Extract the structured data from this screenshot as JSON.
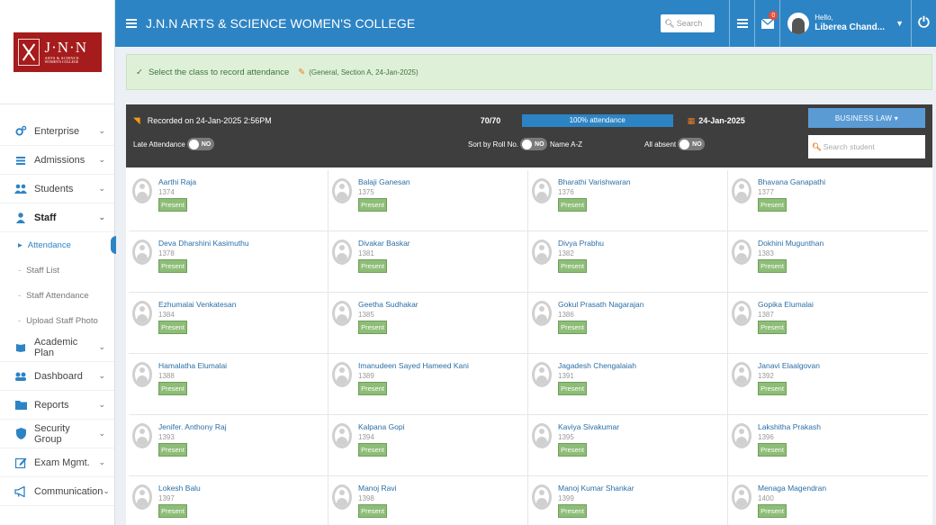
{
  "logo": {
    "name": "J·N·N",
    "line1": "ARTS & SCIENCE",
    "line2": "WOMEN'S COLLEGE"
  },
  "header": {
    "college": "J.N.N ARTS & SCIENCE WOMEN'S COLLEGE",
    "search_placeholder": "Search",
    "mail_count": "0",
    "greeting": "Hello,",
    "user_name": "Liberea Chand..."
  },
  "sidebar": {
    "items": [
      {
        "label": "Enterprise",
        "icon": "cogs-icon"
      },
      {
        "label": "Admissions",
        "icon": "list-icon"
      },
      {
        "label": "Students",
        "icon": "users-icon"
      },
      {
        "label": "Staff",
        "icon": "user-icon"
      },
      {
        "label": "Academic Plan",
        "icon": "book-icon"
      },
      {
        "label": "Dashboard",
        "icon": "dashboard-icon"
      },
      {
        "label": "Reports",
        "icon": "folder-icon"
      },
      {
        "label": "Security Group",
        "icon": "shield-icon"
      },
      {
        "label": "Exam Mgmt.",
        "icon": "edit-icon"
      },
      {
        "label": "Communication",
        "icon": "megaphone-icon"
      }
    ],
    "staff_sub": [
      "Attendance",
      "Staff List",
      "Staff Attendance",
      "Upload Staff Photo"
    ]
  },
  "alert": {
    "message": "Select the class to record attendance",
    "meta": "(General, Section A, 24-Jan-2025)"
  },
  "attendance": {
    "recorded": "Recorded on 24-Jan-2025 2:56PM",
    "count": "70/70",
    "percent_label": "100% attendance",
    "percent": 100,
    "date": "24-Jan-2025",
    "subject_button": "BUSINESS LAW ▾",
    "late_label": "Late Attendance",
    "sort_label": "Sort by Roll No.",
    "sort_alt": "Name A-Z",
    "absent_label": "All absent",
    "toggle_no": "NO",
    "search_placeholder": "Search student"
  },
  "students": [
    {
      "name": "Aarthi Raja",
      "roll": "1374",
      "status": "Present"
    },
    {
      "name": "Balaji Ganesan",
      "roll": "1375",
      "status": "Present"
    },
    {
      "name": "Bharathi Varishwaran",
      "roll": "1376",
      "status": "Present"
    },
    {
      "name": "Bhavana Ganapathi",
      "roll": "1377",
      "status": "Present"
    },
    {
      "name": "Deva Dharshini Kasimuthu",
      "roll": "1378",
      "status": "Present"
    },
    {
      "name": "Divakar Baskar",
      "roll": "1381",
      "status": "Present"
    },
    {
      "name": "Divya Prabhu",
      "roll": "1382",
      "status": "Present"
    },
    {
      "name": "Dokhini Mugunthan",
      "roll": "1383",
      "status": "Present"
    },
    {
      "name": "Ezhumalai Venkatesan",
      "roll": "1384",
      "status": "Present"
    },
    {
      "name": "Geetha Sudhakar",
      "roll": "1385",
      "status": "Present"
    },
    {
      "name": "Gokul Prasath Nagarajan",
      "roll": "1386",
      "status": "Present"
    },
    {
      "name": "Gopika Elumalai",
      "roll": "1387",
      "status": "Present"
    },
    {
      "name": "Hamalatha Elumalai",
      "roll": "1388",
      "status": "Present"
    },
    {
      "name": "Imanudeen Sayed Hameed Kani",
      "roll": "1389",
      "status": "Present"
    },
    {
      "name": "Jagadesh Chengalaiah",
      "roll": "1391",
      "status": "Present"
    },
    {
      "name": "Janavi Elaalgovan",
      "roll": "1392",
      "status": "Present"
    },
    {
      "name": "Jenifer. Anthony Raj",
      "roll": "1393",
      "status": "Present"
    },
    {
      "name": "Kalpana Gopi",
      "roll": "1394",
      "status": "Present"
    },
    {
      "name": "Kaviya Sivakumar",
      "roll": "1395",
      "status": "Present"
    },
    {
      "name": "Lakshitha Prakash",
      "roll": "1396",
      "status": "Present"
    },
    {
      "name": "Lokesh Balu",
      "roll": "1397",
      "status": "Present"
    },
    {
      "name": "Manoj Ravi",
      "roll": "1398",
      "status": "Present"
    },
    {
      "name": "Manoj Kumar Shankar",
      "roll": "1399",
      "status": "Present"
    },
    {
      "name": "Menaga Magendran",
      "roll": "1400",
      "status": "Present"
    }
  ],
  "colors": {
    "primary": "#2d84c4",
    "present": "#8dbd77",
    "dark_bar": "#3e3e3e"
  }
}
